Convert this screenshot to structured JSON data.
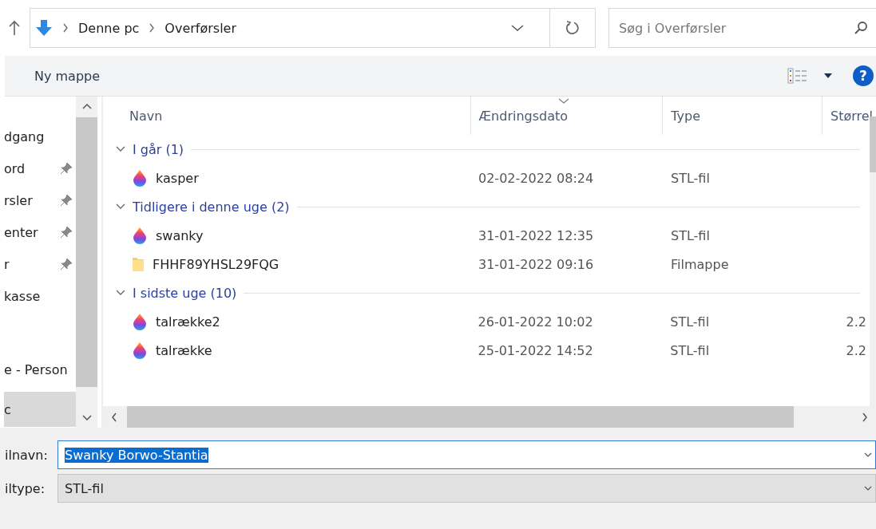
{
  "address": {
    "crumbs": [
      "Denne pc",
      "Overførsler"
    ]
  },
  "search": {
    "placeholder": "Søg i Overførsler"
  },
  "toolbar": {
    "new_folder": "Ny mappe",
    "help": "?"
  },
  "sidebar": {
    "items": [
      {
        "label": "dgang",
        "pinned": false,
        "selected": false
      },
      {
        "label": "ord",
        "pinned": true,
        "selected": false
      },
      {
        "label": "rsler",
        "pinned": true,
        "selected": false
      },
      {
        "label": "enter",
        "pinned": true,
        "selected": false
      },
      {
        "label": "r",
        "pinned": true,
        "selected": false
      },
      {
        "label": "kasse",
        "pinned": false,
        "selected": false
      },
      {
        "label": "e - Person",
        "pinned": false,
        "selected": false
      },
      {
        "label": "c",
        "pinned": false,
        "selected": true
      }
    ]
  },
  "table": {
    "columns": [
      "Navn",
      "Ændringsdato",
      "Type",
      "Størrel"
    ],
    "groups": [
      {
        "label": "I går (1)",
        "expanded": true,
        "rows": [
          {
            "name": "kasper",
            "date": "02-02-2022 08:24",
            "type": "STL-fil",
            "kind": "stl"
          }
        ]
      },
      {
        "label": "Tidligere i denne uge (2)",
        "expanded": true,
        "rows": [
          {
            "name": "swanky",
            "date": "31-01-2022 12:35",
            "type": "STL-fil",
            "kind": "stl"
          },
          {
            "name": "FHHF89YHSL29FQG",
            "date": "31-01-2022 09:16",
            "type": "Filmappe",
            "kind": "folder"
          }
        ]
      },
      {
        "label": "I sidste uge (10)",
        "expanded": true,
        "rows": [
          {
            "name": "talrække2",
            "date": "26-01-2022 10:02",
            "type": "STL-fil",
            "size": "2.2",
            "kind": "stl"
          },
          {
            "name": "talrække",
            "date": "25-01-2022 14:52",
            "type": "STL-fil",
            "size": "2.2",
            "kind": "stl"
          }
        ]
      }
    ]
  },
  "filename": {
    "label": "ilnavn:",
    "value": "Swanky Borwo-Stantia",
    "selected": true
  },
  "filetype": {
    "label": "iltype:",
    "value": "STL-fil"
  }
}
